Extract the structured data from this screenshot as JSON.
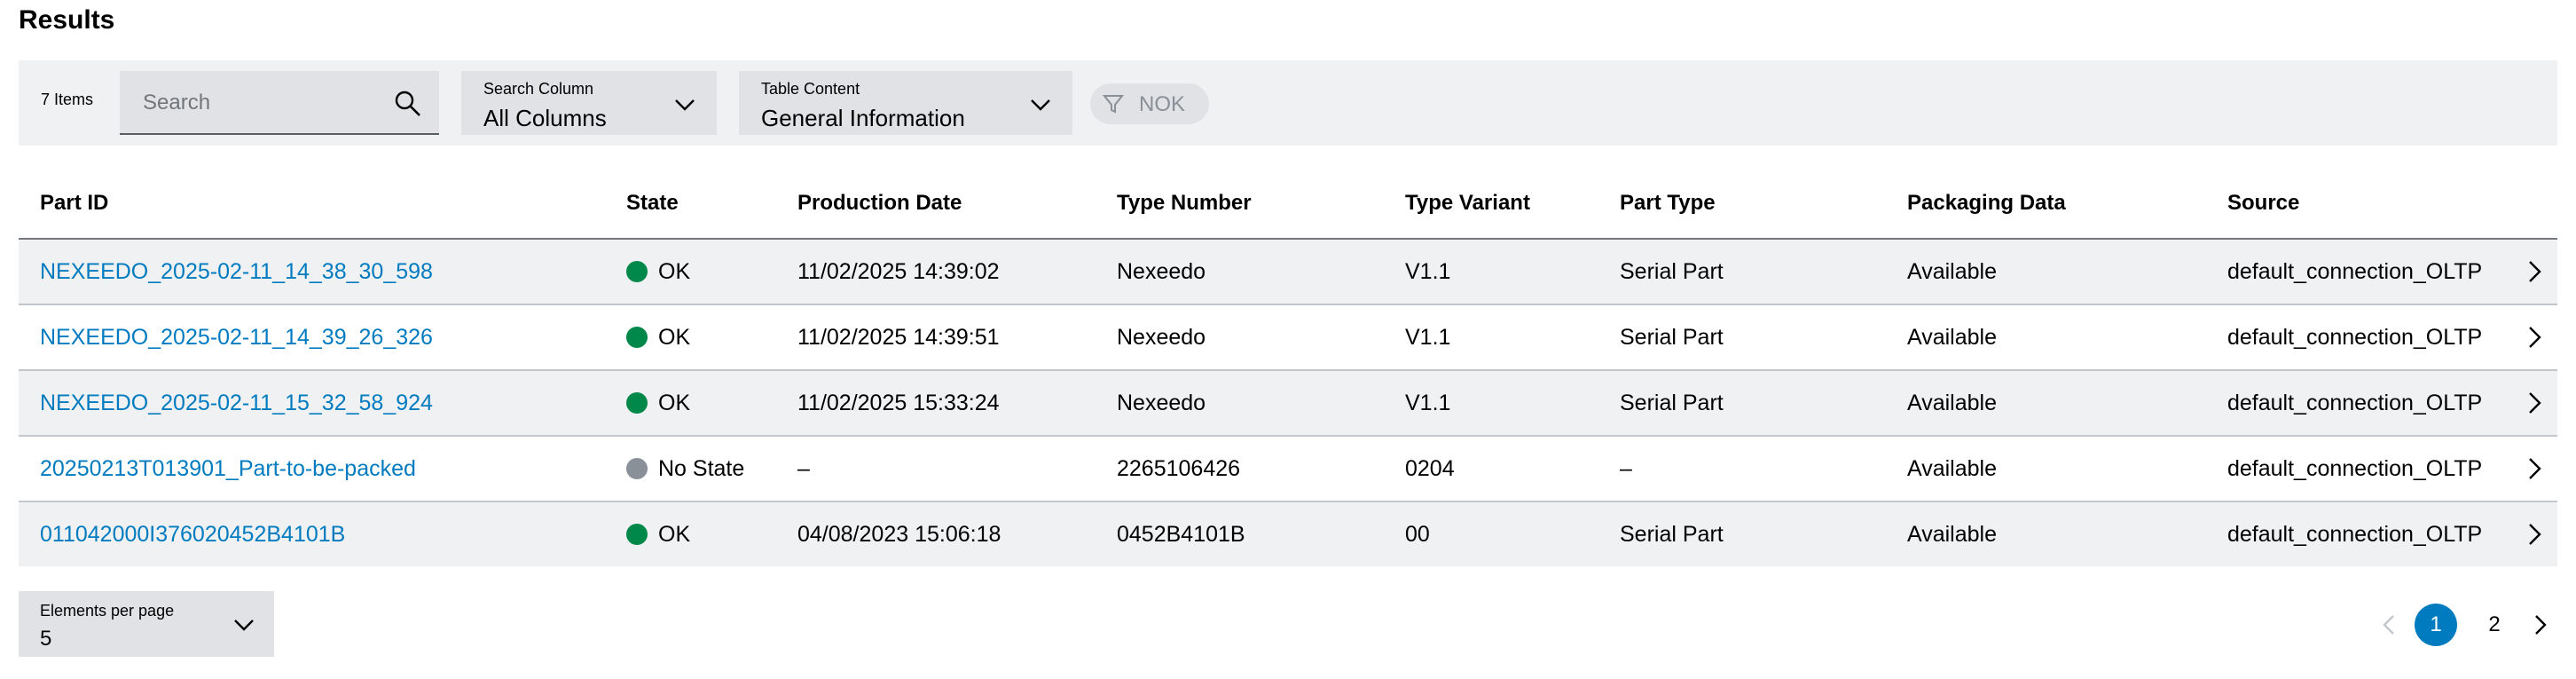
{
  "title": "Results",
  "toolbar": {
    "items_count": "7 Items",
    "search": {
      "placeholder": "Search"
    },
    "search_column": {
      "label": "Search Column",
      "value": "All Columns"
    },
    "table_content": {
      "label": "Table Content",
      "value": "General Information"
    },
    "filter_chip": {
      "label": "NOK"
    }
  },
  "table": {
    "headers": [
      "Part ID",
      "State",
      "Production Date",
      "Type Number",
      "Type Variant",
      "Part Type",
      "Packaging Data",
      "Source"
    ],
    "rows": [
      {
        "part_id": "NEXEEDO_2025-02-11_14_38_30_598",
        "state": "OK",
        "state_color": "#00884a",
        "production_date": "11/02/2025 14:39:02",
        "type_number": "Nexeedo",
        "type_variant": "V1.1",
        "part_type": "Serial Part",
        "packaging": "Available",
        "source": "default_connection_OLTP"
      },
      {
        "part_id": "NEXEEDO_2025-02-11_14_39_26_326",
        "state": "OK",
        "state_color": "#00884a",
        "production_date": "11/02/2025 14:39:51",
        "type_number": "Nexeedo",
        "type_variant": "V1.1",
        "part_type": "Serial Part",
        "packaging": "Available",
        "source": "default_connection_OLTP"
      },
      {
        "part_id": "NEXEEDO_2025-02-11_15_32_58_924",
        "state": "OK",
        "state_color": "#00884a",
        "production_date": "11/02/2025 15:33:24",
        "type_number": "Nexeedo",
        "type_variant": "V1.1",
        "part_type": "Serial Part",
        "packaging": "Available",
        "source": "default_connection_OLTP"
      },
      {
        "part_id": "20250213T013901_Part-to-be-packed",
        "state": "No State",
        "state_color": "#8a9097",
        "production_date": "–",
        "type_number": "2265106426",
        "type_variant": "0204",
        "part_type": "–",
        "packaging": "Available",
        "source": "default_connection_OLTP"
      },
      {
        "part_id": "011042000I376020452B4101B",
        "state": "OK",
        "state_color": "#00884a",
        "production_date": "04/08/2023 15:06:18",
        "type_number": "0452B4101B",
        "type_variant": "00",
        "part_type": "Serial Part",
        "packaging": "Available",
        "source": "default_connection_OLTP"
      }
    ]
  },
  "pagination": {
    "elements_per_page": {
      "label": "Elements per page",
      "value": "5"
    },
    "pages": [
      "1",
      "2"
    ],
    "current_page": "1"
  },
  "colors": {
    "accent": "#007bc0",
    "ok": "#00884a",
    "neutral": "#8a9097"
  }
}
